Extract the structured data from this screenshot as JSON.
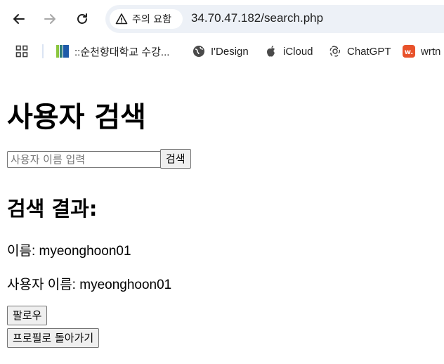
{
  "browser": {
    "security_label": "주의 요함",
    "url": "34.70.47.182/search.php",
    "bookmarks": [
      {
        "label": "::순천향대학교 수강...",
        "icon": "bookmark-stripes-icon"
      },
      {
        "label": "I'Design",
        "icon": "globe-icon"
      },
      {
        "label": "iCloud",
        "icon": "apple-icon"
      },
      {
        "label": "ChatGPT",
        "icon": "openai-icon"
      },
      {
        "label": "wrtn",
        "icon": "wrtn-icon"
      }
    ]
  },
  "page": {
    "title": "사용자 검색",
    "search_placeholder": "사용자 이름 입력",
    "search_button": "검색",
    "results_heading": "검색 결과:",
    "result_name_line": "이름: myeonghoon01",
    "result_username_line": "사용자 이름: myeonghoon01",
    "follow_button": "팔로우",
    "back_button": "프로필로 돌아가기"
  },
  "colors": {
    "omnibox_bg": "#edf1f7",
    "button_bg": "#efefef",
    "wrtn_brand": "#e8522b"
  }
}
